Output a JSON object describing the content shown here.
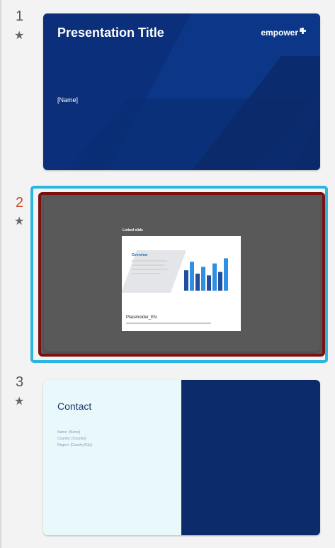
{
  "slides": [
    {
      "number": "1",
      "title": "Presentation Title",
      "name_placeholder": "[Name]",
      "logo": "empower",
      "starred": true
    },
    {
      "number": "2",
      "label": "Linked slide",
      "mini_heading": "Overview",
      "mini_footer": "Placeholder_EN",
      "starred": true,
      "selected": true
    },
    {
      "number": "3",
      "title": "Contact",
      "lines": [
        "Name: [Name]",
        "Country: [Country]",
        "Region: [Country/City]"
      ],
      "starred": true
    }
  ],
  "star_glyph": "★",
  "colors": {
    "selection": "#2ab6e0",
    "active_number": "#d24726",
    "slide_navy": "#0b2f7a"
  },
  "chart": {
    "bars": [
      0.6,
      0.85,
      0.5,
      0.7,
      0.45,
      0.8,
      0.55,
      0.95
    ]
  }
}
